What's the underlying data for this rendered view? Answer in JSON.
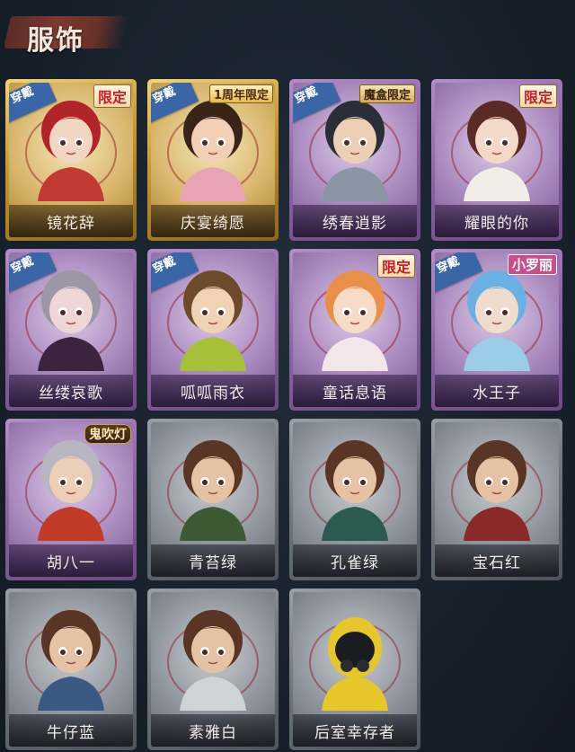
{
  "section": {
    "title": "服饰"
  },
  "worn_label": "穿戴",
  "cards": [
    {
      "name": "镜花辞",
      "theme": "gold",
      "worn": true,
      "badge": "限定",
      "badge_style": "limited",
      "hair": "#b0242a",
      "outfit": "#c23a33",
      "skin": "#f2d6c4"
    },
    {
      "name": "庆宴绮愿",
      "theme": "gold",
      "worn": true,
      "badge": "1周年限定",
      "badge_style": "anniv",
      "hair": "#3a2418",
      "outfit": "#e8a4b4",
      "skin": "#f2d0b6"
    },
    {
      "name": "绣春逍影",
      "theme": "purple",
      "worn": true,
      "badge": "魔盒限定",
      "badge_style": "box",
      "hair": "#2a2e36",
      "outfit": "#8a96a4",
      "skin": "#eccfb6"
    },
    {
      "name": "耀眼的你",
      "theme": "purple",
      "worn": false,
      "badge": "限定",
      "badge_style": "limited",
      "hair": "#5a2a24",
      "outfit": "#f2ede6",
      "skin": "#f4d8c8"
    },
    {
      "name": "丝缕哀歌",
      "theme": "purple",
      "worn": true,
      "badge": "",
      "badge_style": "",
      "hair": "#9c96a6",
      "outfit": "#3a2440",
      "skin": "#efd6d6"
    },
    {
      "name": "呱呱雨衣",
      "theme": "purple",
      "worn": true,
      "badge": "",
      "badge_style": "",
      "hair": "#6e4a2c",
      "outfit": "#a6c03a",
      "skin": "#f0d2b6"
    },
    {
      "name": "童话息语",
      "theme": "purple",
      "worn": false,
      "badge": "限定",
      "badge_style": "limited",
      "hair": "#e8904a",
      "outfit": "#f2e6ea",
      "skin": "#f6dcc8"
    },
    {
      "name": "水王子",
      "theme": "purple",
      "worn": true,
      "badge": "小罗丽",
      "badge_style": "pink",
      "hair": "#6ab0e4",
      "outfit": "#9ccde8",
      "skin": "#f0dccc"
    },
    {
      "name": "胡八一",
      "theme": "purple",
      "worn": false,
      "badge": "鬼吹灯",
      "badge_style": "ghost",
      "hair": "#b8b6c0",
      "outfit": "#c23a28",
      "skin": "#eccfb6"
    },
    {
      "name": "青苔绿",
      "theme": "gray",
      "worn": false,
      "badge": "",
      "badge_style": "",
      "hair": "#5a3424",
      "outfit": "#3e5a34",
      "skin": "#e6c2a4"
    },
    {
      "name": "孔雀绿",
      "theme": "gray",
      "worn": false,
      "badge": "",
      "badge_style": "",
      "hair": "#5a3424",
      "outfit": "#2a5a52",
      "skin": "#e6c2a4"
    },
    {
      "name": "宝石红",
      "theme": "gray",
      "worn": false,
      "badge": "",
      "badge_style": "",
      "hair": "#5a3424",
      "outfit": "#8a2a28",
      "skin": "#e6c2a4"
    },
    {
      "name": "牛仔蓝",
      "theme": "gray",
      "worn": false,
      "badge": "",
      "badge_style": "",
      "hair": "#5a3424",
      "outfit": "#3a5a84",
      "skin": "#e6c2a4"
    },
    {
      "name": "素雅白",
      "theme": "gray",
      "worn": false,
      "badge": "",
      "badge_style": "",
      "hair": "#5a3424",
      "outfit": "#cfd2d6",
      "skin": "#e6c2a4"
    },
    {
      "name": "后室幸存者",
      "theme": "gray",
      "worn": false,
      "badge": "",
      "badge_style": "",
      "hair": "#e6c62a",
      "outfit": "#e6c62a",
      "skin": "#1a1c20"
    }
  ]
}
